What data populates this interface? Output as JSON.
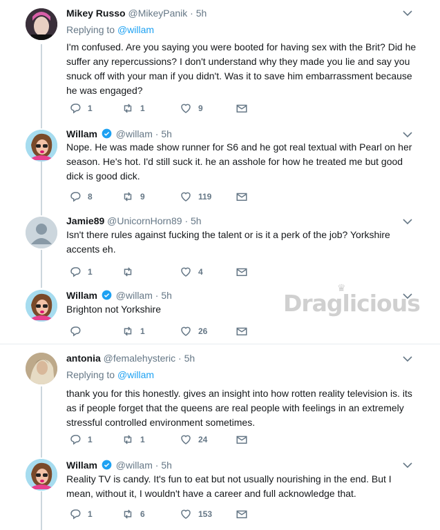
{
  "watermark": "Draglicious",
  "tweets": [
    {
      "name": "Mikey Russo",
      "handle": "@MikeyPanik",
      "time": "5h",
      "replying_label": "Replying to",
      "replying_to": "@willam",
      "text": "I'm confused. Are you saying you were booted for having sex with the Brit? Did he suffer any repercussions? I don't understand why they made you lie and say you snuck off with your man if you didn't. Was it to save him embarrassment because he was engaged?",
      "replies": "1",
      "retweets": "1",
      "likes": "9"
    },
    {
      "name": "Willam",
      "handle": "@willam",
      "time": "5h",
      "verified": true,
      "text": "Nope. He was made show runner for S6 and he got real textual with Pearl on her season. He's hot. I'd still suck it. he an asshole for how he treated me but good dick is good dick.",
      "replies": "8",
      "retweets": "9",
      "likes": "119"
    },
    {
      "name": "Jamie89",
      "handle": "@UnicornHorn89",
      "time": "5h",
      "text": "Isn't there rules against fucking the talent or is it a perk of the job? Yorkshire accents eh.",
      "replies": "1",
      "retweets": "",
      "likes": "4"
    },
    {
      "name": "Willam",
      "handle": "@willam",
      "time": "5h",
      "verified": true,
      "text": "Brighton not Yorkshire",
      "replies": "",
      "retweets": "1",
      "likes": "26"
    },
    {
      "name": "antonia",
      "handle": "@femalehysteric",
      "time": "5h",
      "replying_label": "Replying to",
      "replying_to": "@willam",
      "text": "thank you for this honestly. gives an insight into how rotten reality television is. its as if people forget that the queens are real people with feelings in an extremely stressful controlled environment sometimes.",
      "replies": "1",
      "retweets": "1",
      "likes": "24"
    },
    {
      "name": "Willam",
      "handle": "@willam",
      "time": "5h",
      "verified": true,
      "text": "Reality TV is candy. It's fun to eat but not usually nourishing in the end. But I mean, without it, I wouldn't have a career and full acknowledge that.",
      "replies": "1",
      "retweets": "6",
      "likes": "153"
    }
  ],
  "colors": {
    "link": "#1da1f2",
    "muted": "#657786",
    "thread": "#ccd6dd"
  }
}
